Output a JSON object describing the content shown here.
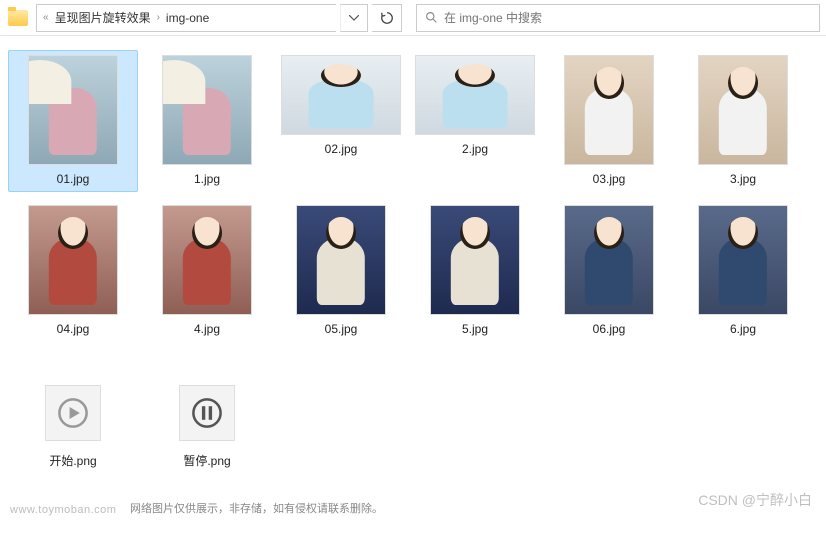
{
  "toolbar": {
    "breadcrumb": {
      "prefix": "«",
      "seg1": "呈现图片旋转效果",
      "seg2": "img-one"
    },
    "search_placeholder": "在 img-one 中搜索"
  },
  "files": [
    {
      "name": "01.jpg",
      "selected": true,
      "shape": "tall",
      "bg1": "#bcd2dc",
      "bg2": "#8ea8b5",
      "cloth": "#d8a9b5",
      "extra": "umbrella"
    },
    {
      "name": "1.jpg",
      "selected": false,
      "shape": "tall",
      "bg1": "#bcd2dc",
      "bg2": "#8ea8b5",
      "cloth": "#d8a9b5",
      "extra": "umbrella"
    },
    {
      "name": "02.jpg",
      "selected": false,
      "shape": "wide",
      "bg1": "#e8eef2",
      "bg2": "#cfd9e0",
      "cloth": "#bcdff0"
    },
    {
      "name": "2.jpg",
      "selected": false,
      "shape": "wide",
      "bg1": "#e8eef2",
      "bg2": "#cfd9e0",
      "cloth": "#bcdff0"
    },
    {
      "name": "03.jpg",
      "selected": false,
      "shape": "tall",
      "bg1": "#e3d4c2",
      "bg2": "#c9b69e",
      "cloth": "#f2f2f2"
    },
    {
      "name": "3.jpg",
      "selected": false,
      "shape": "tall",
      "bg1": "#e3d4c2",
      "bg2": "#c9b69e",
      "cloth": "#f2f2f2"
    },
    {
      "name": "04.jpg",
      "selected": false,
      "shape": "tall",
      "bg1": "#c49a8e",
      "bg2": "#8f5f55",
      "cloth": "#b24a3f"
    },
    {
      "name": "4.jpg",
      "selected": false,
      "shape": "tall",
      "bg1": "#c49a8e",
      "bg2": "#8f5f55",
      "cloth": "#b24a3f"
    },
    {
      "name": "05.jpg",
      "selected": false,
      "shape": "tall",
      "bg1": "#3a4a78",
      "bg2": "#1e2a4f",
      "cloth": "#e7e1d3"
    },
    {
      "name": "5.jpg",
      "selected": false,
      "shape": "tall",
      "bg1": "#3a4a78",
      "bg2": "#1e2a4f",
      "cloth": "#e7e1d3"
    },
    {
      "name": "06.jpg",
      "selected": false,
      "shape": "tall",
      "bg1": "#5a6a8a",
      "bg2": "#3a4865",
      "cloth": "#2f4a6e"
    },
    {
      "name": "6.jpg",
      "selected": false,
      "shape": "tall",
      "bg1": "#5a6a8a",
      "bg2": "#3a4865",
      "cloth": "#2f4a6e"
    }
  ],
  "png_files": [
    {
      "name": "开始.png",
      "icon": "play"
    },
    {
      "name": "暂停.png",
      "icon": "pause"
    }
  ],
  "watermark_left": "www.toymoban.com",
  "footer_text": "网络图片仅供展示，非存储，如有侵权请联系删除。",
  "watermark_right": "CSDN @宁醉小白"
}
